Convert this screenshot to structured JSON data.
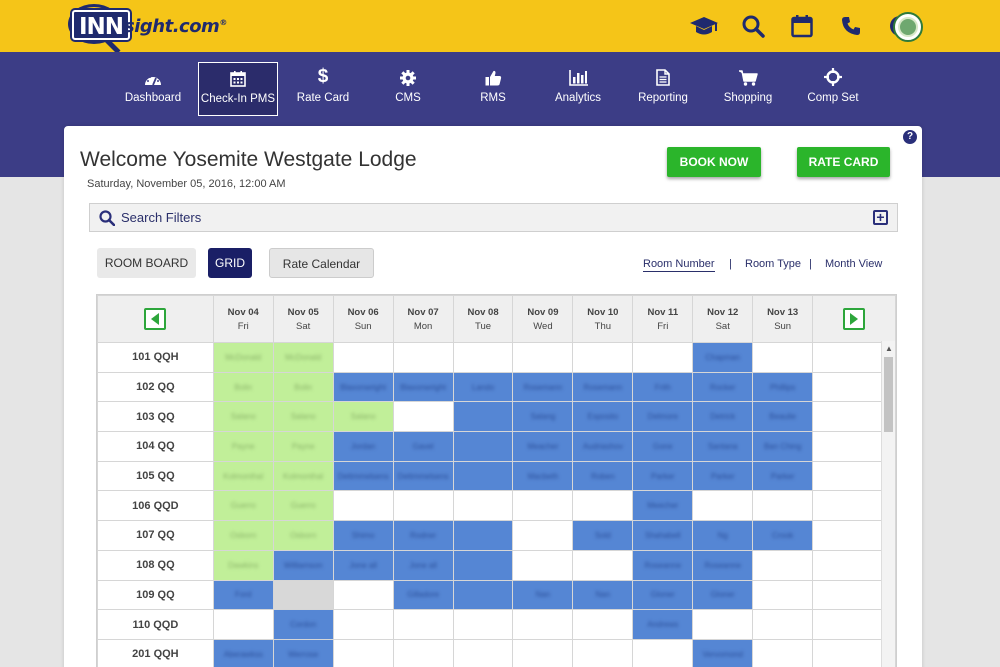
{
  "brand": {
    "logo_inn": "INN",
    "logo_sight": "sight.com",
    "logo_reg": "®"
  },
  "top_icons": [
    "graduation-cap-icon",
    "search-icon",
    "calendar-icon",
    "phone-icon",
    "help-icon"
  ],
  "nav": {
    "items": [
      {
        "label": "Dashboard",
        "icon": "dashboard-icon"
      },
      {
        "label": "Check-In PMS",
        "icon": "calendar-icon",
        "active": true
      },
      {
        "label": "Rate Card",
        "icon": "dollar-icon"
      },
      {
        "label": "CMS",
        "icon": "gear-icon"
      },
      {
        "label": "RMS",
        "icon": "thumbs-up-icon"
      },
      {
        "label": "Analytics",
        "icon": "bar-chart-icon"
      },
      {
        "label": "Reporting",
        "icon": "document-icon"
      },
      {
        "label": "Shopping",
        "icon": "cart-icon"
      },
      {
        "label": "Comp Set",
        "icon": "crosshair-icon"
      }
    ]
  },
  "header": {
    "welcome": "Welcome Yosemite Westgate Lodge",
    "datetime": "Saturday, November 05, 2016, 12:00 AM",
    "book_now": "BOOK NOW",
    "rate_card": "RATE CARD",
    "help": "?"
  },
  "filters": {
    "label": "Search Filters",
    "expand": "+"
  },
  "views": {
    "room_board": "ROOM BOARD",
    "grid": "GRID",
    "rate_calendar": "Rate Calendar",
    "room_number": "Room Number",
    "room_type": "Room Type",
    "month_view": "Month View",
    "separator": "|"
  },
  "colors": {
    "blue": "#5586d4",
    "green": "#c1ef99",
    "gray": "#d8d8d8",
    "nav": "#3c3d86",
    "topbar": "#f5c518",
    "accent_green": "#2bb52b"
  },
  "grid": {
    "dates": [
      {
        "date": "Nov 04",
        "dow": "Fri"
      },
      {
        "date": "Nov 05",
        "dow": "Sat"
      },
      {
        "date": "Nov 06",
        "dow": "Sun"
      },
      {
        "date": "Nov 07",
        "dow": "Mon"
      },
      {
        "date": "Nov 08",
        "dow": "Tue"
      },
      {
        "date": "Nov 09",
        "dow": "Wed"
      },
      {
        "date": "Nov 10",
        "dow": "Thu"
      },
      {
        "date": "Nov 11",
        "dow": "Fri"
      },
      {
        "date": "Nov 12",
        "dow": "Sat"
      },
      {
        "date": "Nov 13",
        "dow": "Sun"
      }
    ],
    "rows": [
      {
        "room": "101 QQH",
        "cells": [
          [
            "g",
            "McDonald"
          ],
          [
            "g",
            "McDonald"
          ],
          [
            "w",
            ""
          ],
          [
            "w",
            ""
          ],
          [
            "w",
            ""
          ],
          [
            "w",
            ""
          ],
          [
            "w",
            ""
          ],
          [
            "w",
            ""
          ],
          [
            "b",
            "Chapman"
          ],
          [
            "w",
            ""
          ]
        ]
      },
      {
        "room": "102 QQ",
        "cells": [
          [
            "g",
            "Bolin"
          ],
          [
            "g",
            "Bolin"
          ],
          [
            "b",
            "Blaxonwright"
          ],
          [
            "b",
            "Blaxonwright"
          ],
          [
            "b",
            "Lando"
          ],
          [
            "b",
            "Rosemann"
          ],
          [
            "b",
            "Rosemann"
          ],
          [
            "b",
            "Frith"
          ],
          [
            "b",
            "Rocker"
          ],
          [
            "b",
            "Phillips"
          ]
        ]
      },
      {
        "room": "103 QQ",
        "cells": [
          [
            "g",
            "Salano"
          ],
          [
            "g",
            "Salano"
          ],
          [
            "g",
            "Salano"
          ],
          [
            "w",
            ""
          ],
          [
            "b",
            ""
          ],
          [
            "b",
            "Salang"
          ],
          [
            "b",
            "Esposito"
          ],
          [
            "b",
            "Delmore"
          ],
          [
            "b",
            "Detrick"
          ],
          [
            "b",
            "Beaulie"
          ]
        ]
      },
      {
        "room": "104 QQ",
        "cells": [
          [
            "g",
            "Payne"
          ],
          [
            "g",
            "Payne"
          ],
          [
            "b",
            "Jordan"
          ],
          [
            "b",
            "Gavel"
          ],
          [
            "b",
            ""
          ],
          [
            "b",
            "Meacher"
          ],
          [
            "b",
            "Audriashov"
          ],
          [
            "b",
            "Gone"
          ],
          [
            "b",
            "Santana"
          ],
          [
            "b",
            "Ban Ching"
          ]
        ]
      },
      {
        "room": "105 QQ",
        "cells": [
          [
            "g",
            "Kolmonthal"
          ],
          [
            "g",
            "Kolmonthal"
          ],
          [
            "b",
            "Dettmmelsens"
          ],
          [
            "b",
            "Dettmmelsens"
          ],
          [
            "b",
            ""
          ],
          [
            "b",
            "Macbeth"
          ],
          [
            "b",
            "Roben"
          ],
          [
            "b",
            "Parker"
          ],
          [
            "b",
            "Parker"
          ],
          [
            "b",
            "Parker"
          ]
        ]
      },
      {
        "room": "106 QQD",
        "cells": [
          [
            "g",
            "Guerro"
          ],
          [
            "g",
            "Guerro"
          ],
          [
            "w",
            ""
          ],
          [
            "w",
            ""
          ],
          [
            "w",
            ""
          ],
          [
            "w",
            ""
          ],
          [
            "w",
            ""
          ],
          [
            "b",
            "Meecher"
          ],
          [
            "w",
            ""
          ],
          [
            "w",
            ""
          ]
        ]
      },
      {
        "room": "107 QQ",
        "cells": [
          [
            "g",
            "Osborn"
          ],
          [
            "g",
            "Osborn"
          ],
          [
            "b",
            "Shimo"
          ],
          [
            "b",
            "Rodner"
          ],
          [
            "b",
            ""
          ],
          [
            "w",
            ""
          ],
          [
            "b",
            "Sold"
          ],
          [
            "b",
            "Shahabell"
          ],
          [
            "b",
            "Ng"
          ],
          [
            "b",
            "Crook"
          ]
        ]
      },
      {
        "room": "108 QQ",
        "cells": [
          [
            "g",
            "Dawkins"
          ],
          [
            "b",
            "Williamson"
          ],
          [
            "b",
            "Jone all"
          ],
          [
            "b",
            "Jone all"
          ],
          [
            "b",
            ""
          ],
          [
            "w",
            ""
          ],
          [
            "w",
            ""
          ],
          [
            "b",
            "Roseanne"
          ],
          [
            "b",
            "Roseanne"
          ],
          [
            "w",
            ""
          ]
        ]
      },
      {
        "room": "109 QQ",
        "cells": [
          [
            "b",
            "Ford"
          ],
          [
            "x",
            ""
          ],
          [
            "w",
            ""
          ],
          [
            "b",
            "Gilladore"
          ],
          [
            "b",
            ""
          ],
          [
            "b",
            "Nan"
          ],
          [
            "b",
            "Nan"
          ],
          [
            "b",
            "Gloner"
          ],
          [
            "b",
            "Gloner"
          ],
          [
            "w",
            ""
          ]
        ]
      },
      {
        "room": "110 QQD",
        "cells": [
          [
            "w",
            ""
          ],
          [
            "b",
            "Cordon"
          ],
          [
            "w",
            ""
          ],
          [
            "w",
            ""
          ],
          [
            "w",
            ""
          ],
          [
            "w",
            ""
          ],
          [
            "w",
            ""
          ],
          [
            "b",
            "Andrews"
          ],
          [
            "w",
            ""
          ],
          [
            "w",
            ""
          ]
        ]
      },
      {
        "room": "201 QQH",
        "cells": [
          [
            "b",
            "Aberawkss"
          ],
          [
            "b",
            "Werrose"
          ],
          [
            "w",
            ""
          ],
          [
            "w",
            ""
          ],
          [
            "w",
            ""
          ],
          [
            "w",
            ""
          ],
          [
            "w",
            ""
          ],
          [
            "w",
            ""
          ],
          [
            "b",
            "Vervomond"
          ],
          [
            "w",
            ""
          ]
        ]
      }
    ]
  }
}
